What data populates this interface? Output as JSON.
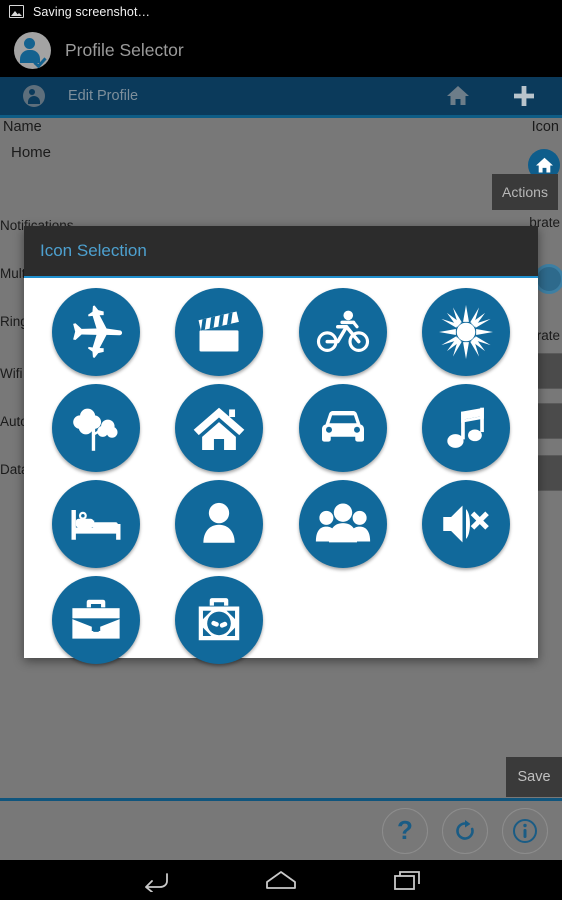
{
  "status_bar": {
    "icon": "screenshot-image-icon",
    "text": "Saving screenshot…"
  },
  "app_bar": {
    "icon": "profile-avatar-icon",
    "title": "Profile Selector"
  },
  "action_bar": {
    "icon": "profile-small-icon",
    "title": "Edit Profile",
    "home_icon": "home-icon",
    "add_icon": "plus-icon"
  },
  "form": {
    "name_header": "Name",
    "icon_header": "Icon",
    "name_value": "Home",
    "selected_icon": "home-icon",
    "actions_label": "Actions",
    "left_labels": [
      "Notifications",
      "Multi",
      "Ring",
      "Wifi",
      "Auto",
      "Data"
    ],
    "right_labels": [
      "brate",
      "brate"
    ]
  },
  "dialog": {
    "title": "Icon Selection",
    "accent_color": "#2090cf",
    "title_color": "#4da0cf",
    "title_bg": "#2c2c2c",
    "icon_color": "#11699b",
    "icons": [
      {
        "name": "airplane-icon"
      },
      {
        "name": "movie-clapperboard-icon"
      },
      {
        "name": "bicycle-icon"
      },
      {
        "name": "starburst-icon"
      },
      {
        "name": "tree-icon"
      },
      {
        "name": "home-icon"
      },
      {
        "name": "car-icon"
      },
      {
        "name": "music-note-icon"
      },
      {
        "name": "bed-icon"
      },
      {
        "name": "person-icon"
      },
      {
        "name": "group-icon"
      },
      {
        "name": "mute-speaker-icon"
      },
      {
        "name": "briefcase-icon"
      },
      {
        "name": "toolcase-icon"
      },
      {
        "name": "empty-slot"
      },
      {
        "name": "empty-slot"
      }
    ]
  },
  "footer": {
    "save_label": "Save",
    "help_label": "?",
    "refresh_icon": "refresh-icon",
    "info_icon": "info-icon"
  },
  "nav_bar": {
    "back_icon": "back-icon",
    "home_icon": "home-outline-icon",
    "recents_icon": "recents-icon"
  }
}
